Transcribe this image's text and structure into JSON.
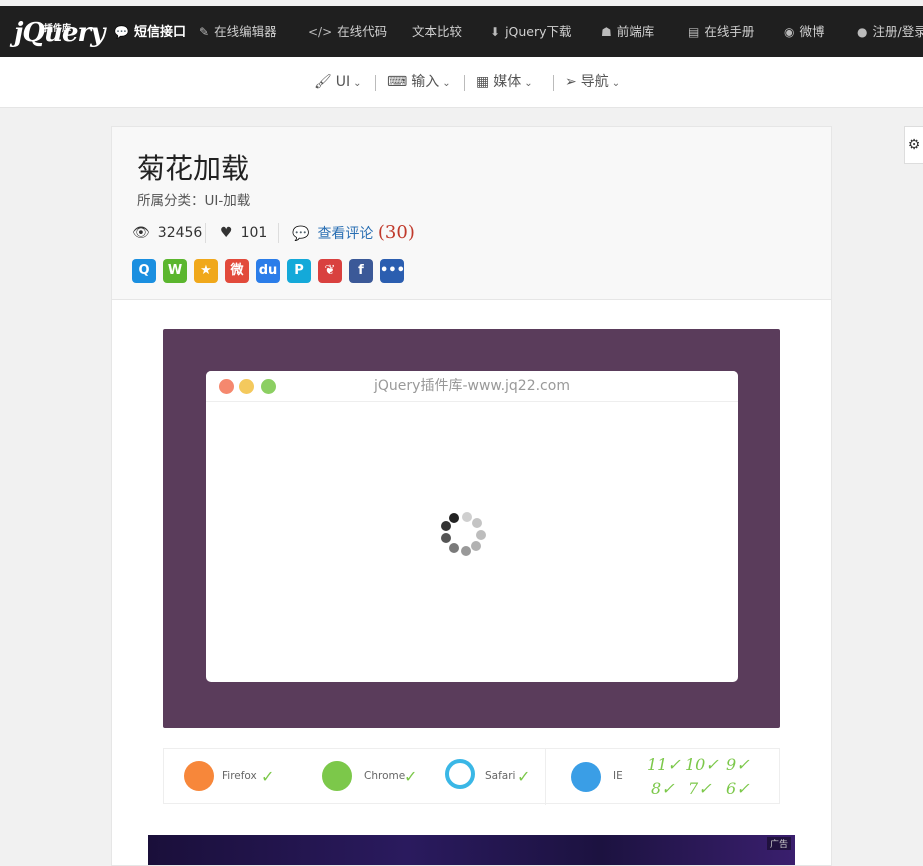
{
  "topnav": {
    "logo_text": "jQuery",
    "logo_sub": "插件库",
    "items": [
      {
        "label": "短信接口",
        "icon": "chat-bubble-icon"
      },
      {
        "label": "在线编辑器",
        "icon": "edit-icon"
      },
      {
        "label": "在线代码",
        "icon": "code-icon"
      },
      {
        "label": "文本比较",
        "icon": ""
      },
      {
        "label": "jQuery下载",
        "icon": "download-icon"
      },
      {
        "label": "前端库",
        "icon": "user-secret-icon"
      },
      {
        "label": "在线手册",
        "icon": "book-icon"
      },
      {
        "label": "微博",
        "icon": "weibo-icon"
      },
      {
        "label": "注册/登录",
        "icon": "user-icon"
      }
    ]
  },
  "subnav": {
    "items": [
      {
        "label": "UI",
        "icon": "paintbrush-icon"
      },
      {
        "label": "输入",
        "icon": "keyboard-icon"
      },
      {
        "label": "媒体",
        "icon": "film-icon"
      },
      {
        "label": "导航",
        "icon": "paper-plane-icon"
      }
    ]
  },
  "plugin": {
    "title": "菊花加载",
    "category": "所属分类：UI-加载",
    "views": "32456",
    "likes": "101",
    "comments_label": "查看评论",
    "comments_count": "(30)"
  },
  "share_buttons": [
    {
      "name": "qq",
      "color": "#1a8fe0",
      "glyph": "Q"
    },
    {
      "name": "wechat",
      "color": "#5bb62e",
      "glyph": "W"
    },
    {
      "name": "qzone",
      "color": "#f0a81b",
      "glyph": "★"
    },
    {
      "name": "weibo",
      "color": "#e24a3b",
      "glyph": "微"
    },
    {
      "name": "baidu",
      "color": "#2b7de9",
      "glyph": "du"
    },
    {
      "name": "renren",
      "color": "#14a9d9",
      "glyph": "P"
    },
    {
      "name": "douban",
      "color": "#d9413f",
      "glyph": "❦"
    },
    {
      "name": "facebook",
      "color": "#3b5998",
      "glyph": "f"
    },
    {
      "name": "more",
      "color": "#2b5eb0",
      "glyph": "•••"
    }
  ],
  "demo": {
    "window_title": "jQuery插件库-www.jq22.com",
    "dot_colors": [
      "#f5886e",
      "#f4c95d",
      "#8ccf62"
    ],
    "bg_color": "#5a3c5b"
  },
  "browsers": [
    {
      "name": "Firefox",
      "color": "#f7873a"
    },
    {
      "name": "Chrome",
      "color": "#7cc84a"
    },
    {
      "name": "Safari",
      "color": "#3ab7e6"
    },
    {
      "name": "IE",
      "color": "#3a9ee6"
    }
  ],
  "ie_versions": [
    "11",
    "10",
    "9",
    "8",
    "7",
    "6"
  ],
  "ad_label": "广告"
}
